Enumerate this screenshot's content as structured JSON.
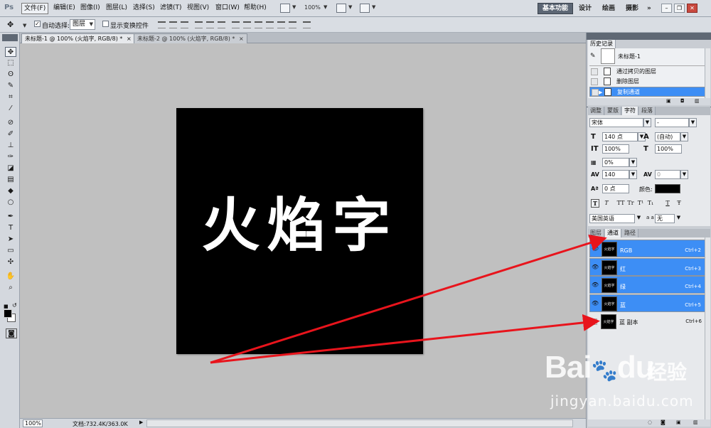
{
  "app": {
    "logo": "Ps"
  },
  "menubar": {
    "items": [
      "文件(F)",
      "编辑(E)",
      "图像(I)",
      "图层(L)",
      "选择(S)",
      "滤镜(T)",
      "视图(V)",
      "窗口(W)",
      "帮助(H)"
    ],
    "zoom": "100%",
    "workspaces": [
      "基本功能",
      "设计",
      "绘画",
      "摄影"
    ],
    "more": "»"
  },
  "options": {
    "auto_select_label": "自动选择:",
    "auto_select_value": "图层",
    "show_transform_label": "显示变换控件"
  },
  "tabs": [
    {
      "label": "未标题-1 @ 100% (火焰字, RGB/8) *",
      "close": "×"
    },
    {
      "label": "未标题-2 @ 100% (火焰字, RGB/8) *",
      "close": "×"
    }
  ],
  "canvas": {
    "text": "火焰字"
  },
  "status": {
    "zoom": "100%",
    "doc": "文档:732.4K/363.0K"
  },
  "history": {
    "tab": "历史记录",
    "snapshot": "未标题-1",
    "items": [
      {
        "label": "通过拷贝的图层"
      },
      {
        "label": "删除图层"
      },
      {
        "label": "复制通道"
      }
    ]
  },
  "character": {
    "tabs": [
      "调整",
      "蒙版",
      "字符",
      "段落"
    ],
    "font_family": "宋体",
    "font_style": "-",
    "size": "140 点",
    "leading": "(自动)",
    "vscale": "100%",
    "hscale": "100%",
    "tsume": "0%",
    "tracking": "140",
    "kerning": "0",
    "baseline": "0 点",
    "color_label": "颜色:",
    "color": "#000000",
    "style_buttons": [
      "T",
      "T",
      "TT",
      "Tr",
      "T¹",
      "T₁",
      "T",
      "Ŧ"
    ],
    "language": "美国英语",
    "aa_label": "a a",
    "aa": "无"
  },
  "channels": {
    "tabs": [
      "图层",
      "通道",
      "路径"
    ],
    "items": [
      {
        "name": "RGB",
        "shortcut": "Ctrl+2",
        "thumb": "火焰字",
        "eye": "👁"
      },
      {
        "name": "红",
        "shortcut": "Ctrl+3",
        "thumb": "火焰字",
        "eye": "👁"
      },
      {
        "name": "绿",
        "shortcut": "Ctrl+4",
        "thumb": "火焰字",
        "eye": "👁"
      },
      {
        "name": "蓝",
        "shortcut": "Ctrl+5",
        "thumb": "火焰字",
        "eye": "👁"
      },
      {
        "name": "蓝 副本",
        "shortcut": "Ctrl+6",
        "thumb": "火焰字",
        "eye": ""
      }
    ]
  },
  "watermark": {
    "logo": "Bai",
    "logo2": "du",
    "cn": "经验",
    "url": "jingyan.baidu.com"
  },
  "colors": {
    "accent": "#3d8ef5",
    "arrow": "#e8141c",
    "canvas": "#000000"
  }
}
